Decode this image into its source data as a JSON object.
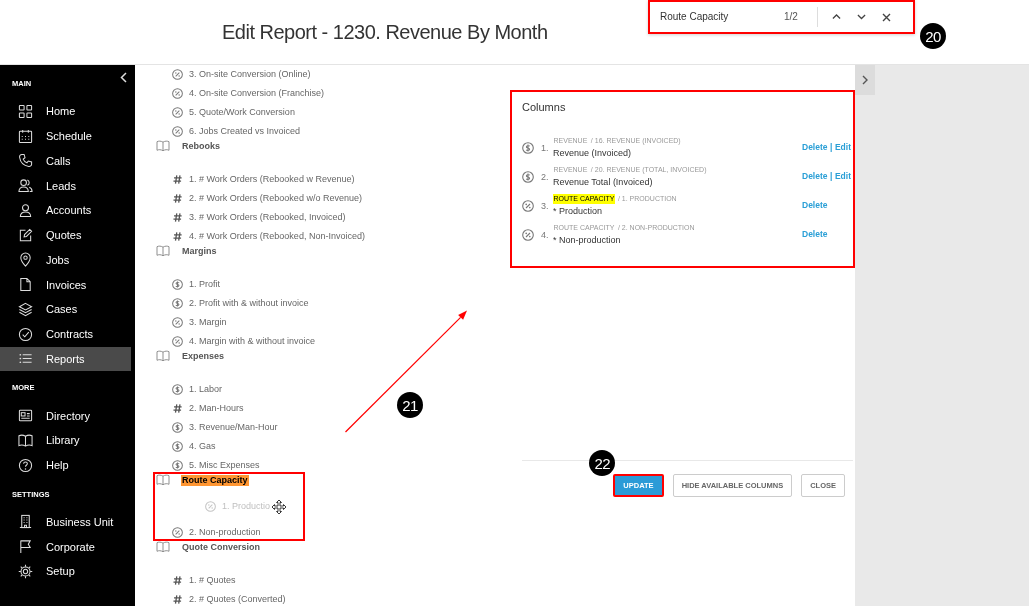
{
  "page_title": "Edit Report - 1230. Revenue By Month",
  "find_bar": {
    "query": "Route Capacity",
    "match_count": "1/2",
    "highlighted": true,
    "callout": "20"
  },
  "sidebar": {
    "sections": [
      {
        "label": "MAIN",
        "items": [
          {
            "label": "Home",
            "selected": false
          },
          {
            "label": "Schedule",
            "selected": false
          },
          {
            "label": "Calls",
            "selected": false
          },
          {
            "label": "Leads",
            "selected": false
          },
          {
            "label": "Accounts",
            "selected": false
          },
          {
            "label": "Quotes",
            "selected": false
          },
          {
            "label": "Jobs",
            "selected": false
          },
          {
            "label": "Invoices",
            "selected": false
          },
          {
            "label": "Cases",
            "selected": false
          },
          {
            "label": "Contracts",
            "selected": false
          },
          {
            "label": "Reports",
            "selected": true
          }
        ]
      },
      {
        "label": "MORE",
        "items": [
          {
            "label": "Directory",
            "selected": false
          },
          {
            "label": "Library",
            "selected": false
          },
          {
            "label": "Help",
            "selected": false
          }
        ]
      },
      {
        "label": "SETTINGS",
        "items": [
          {
            "label": "Business Unit",
            "selected": false
          },
          {
            "label": "Corporate",
            "selected": false
          },
          {
            "label": "Setup",
            "selected": false
          }
        ]
      }
    ]
  },
  "available_columns": {
    "groups": [
      {
        "items": [
          {
            "kind": "percent",
            "label": "3. On-site Conversion (Online)",
            "dragging": false
          },
          {
            "kind": "percent",
            "label": "4. On-site Conversion (Franchise)",
            "dragging": false
          },
          {
            "kind": "percent",
            "label": "5. Quote/Work Conversion",
            "dragging": false
          },
          {
            "kind": "percent",
            "label": "6. Jobs Created vs Invoiced",
            "dragging": false
          }
        ]
      },
      {
        "title": "Rebooks",
        "current_match": false,
        "highlighted": false,
        "items": [
          {
            "kind": "count",
            "label": "1. # Work Orders (Rebooked w Revenue)",
            "dragging": false
          },
          {
            "kind": "count",
            "label": "2. # Work Orders (Rebooked w/o Revenue)",
            "dragging": false
          },
          {
            "kind": "count",
            "label": "3. # Work Orders (Rebooked, Invoiced)",
            "dragging": false
          },
          {
            "kind": "count",
            "label": "4. # Work Orders (Rebooked, Non-Invoiced)",
            "dragging": false
          }
        ]
      },
      {
        "title": "Margins",
        "current_match": false,
        "highlighted": false,
        "items": [
          {
            "kind": "currency",
            "label": "1. Profit",
            "dragging": false
          },
          {
            "kind": "currency",
            "label": "2. Profit with & without invoice",
            "dragging": false
          },
          {
            "kind": "percent",
            "label": "3. Margin",
            "dragging": false
          },
          {
            "kind": "percent",
            "label": "4. Margin with & without invoice",
            "dragging": false
          }
        ]
      },
      {
        "title": "Expenses",
        "current_match": false,
        "highlighted": false,
        "items": [
          {
            "kind": "currency",
            "label": "1. Labor",
            "dragging": false
          },
          {
            "kind": "count",
            "label": "2. Man-Hours",
            "dragging": false
          },
          {
            "kind": "currency",
            "label": "3. Revenue/Man-Hour",
            "dragging": false
          },
          {
            "kind": "currency",
            "label": "4. Gas",
            "dragging": false
          },
          {
            "kind": "currency",
            "label": "5. Misc Expenses",
            "dragging": false
          }
        ]
      },
      {
        "title": "Route Capacity",
        "current_match": true,
        "highlighted": true,
        "items": [
          {
            "kind": "percent",
            "label": "1. Productio",
            "dragging": true
          },
          {
            "kind": "percent",
            "label": "2. Non-production",
            "dragging": false
          }
        ]
      },
      {
        "title": "Quote Conversion",
        "current_match": false,
        "highlighted": false,
        "items": [
          {
            "kind": "count",
            "label": "1. # Quotes",
            "dragging": false
          },
          {
            "kind": "count",
            "label": "2. # Quotes (Converted)",
            "dragging": false
          }
        ]
      }
    ]
  },
  "drag_arrow": {
    "callout": "21"
  },
  "columns_panel": {
    "title": "Columns",
    "highlighted": true,
    "rows": [
      {
        "kind": "currency",
        "number": "1.",
        "category": "REVENUE",
        "search_match": false,
        "path": "/ 16. REVENUE (INVOICED)",
        "name": "Revenue (Invoiced)",
        "actions": [
          "Delete",
          "Edit"
        ],
        "action_separator": "|"
      },
      {
        "kind": "currency",
        "number": "2.",
        "category": "REVENUE",
        "search_match": false,
        "path": "/ 20. REVENUE (TOTAL, INVOICED)",
        "name": "Revenue Total (Invoiced)",
        "actions": [
          "Delete",
          "Edit"
        ],
        "action_separator": "|"
      },
      {
        "kind": "percent",
        "number": "3.",
        "category": "ROUTE CAPACITY",
        "search_match": true,
        "path": "/ 1. PRODUCTION",
        "name": "* Production",
        "actions": [
          "Delete"
        ]
      },
      {
        "kind": "percent",
        "number": "4.",
        "category": "ROUTE CAPACITY",
        "search_match": false,
        "path": "/ 2. NON-PRODUCTION",
        "name": "* Non-production",
        "actions": [
          "Delete"
        ]
      }
    ]
  },
  "buttons": [
    {
      "label": "UPDATE",
      "kind": "primary",
      "highlighted": true,
      "callout": "22"
    },
    {
      "label": "HIDE AVAILABLE COLUMNS",
      "kind": "secondary",
      "highlighted": false
    },
    {
      "label": "CLOSE",
      "kind": "secondary",
      "highlighted": false
    }
  ]
}
